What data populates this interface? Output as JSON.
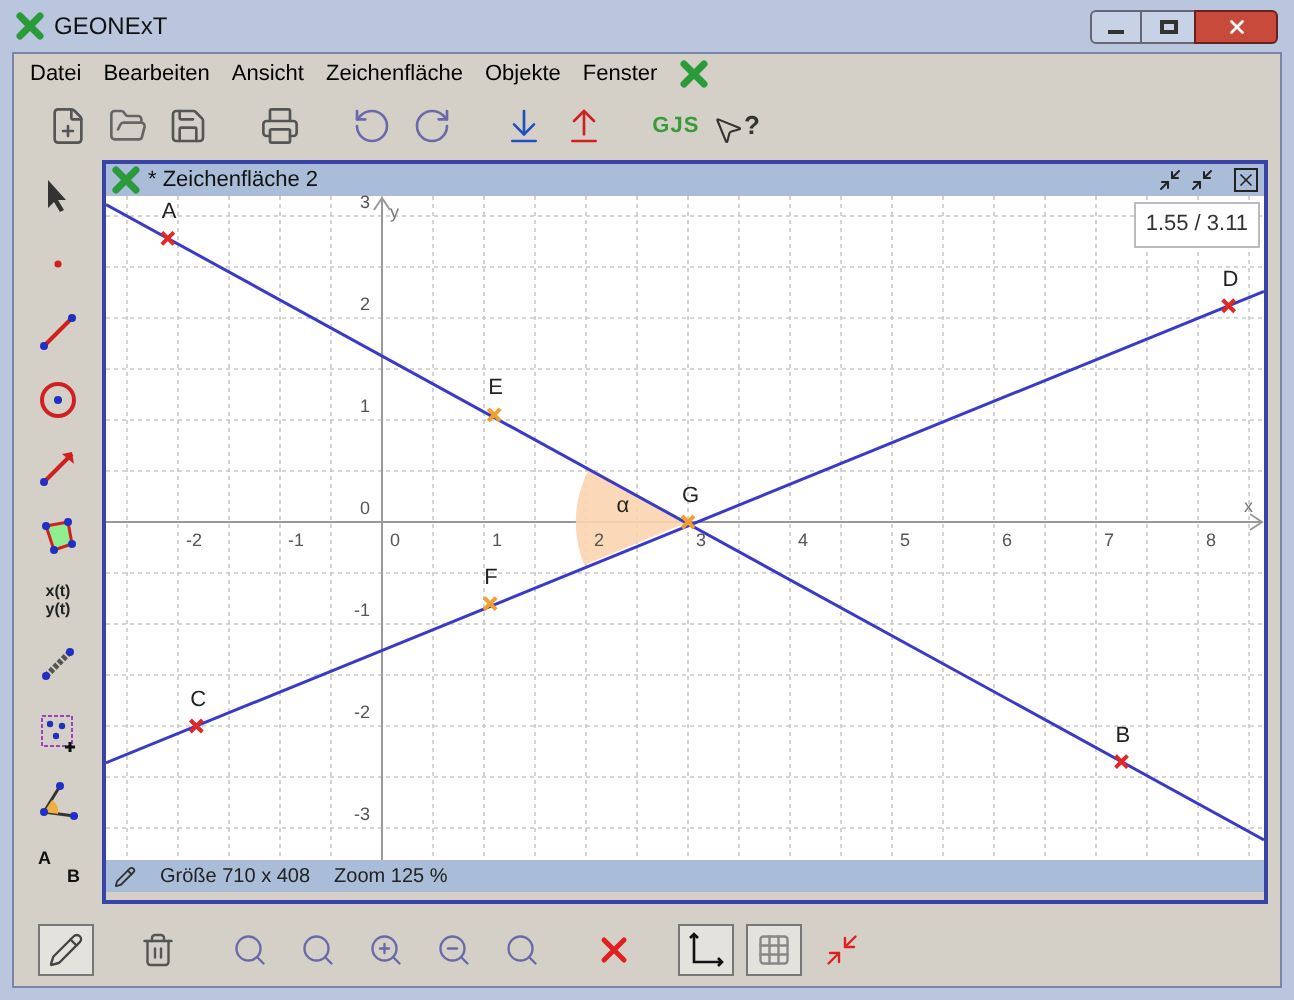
{
  "window": {
    "title": "GEONExT"
  },
  "menu": [
    "Datei",
    "Bearbeiten",
    "Ansicht",
    "Zeichenfläche",
    "Objekte",
    "Fenster"
  ],
  "toolbar": [
    {
      "kind": "new"
    },
    {
      "kind": "open"
    },
    {
      "kind": "save"
    },
    {
      "kind": "print"
    },
    {
      "kind": "undo"
    },
    {
      "kind": "redo"
    },
    {
      "kind": "import"
    },
    {
      "kind": "export"
    },
    {
      "kind": "text",
      "text": "GJS"
    },
    {
      "kind": "help",
      "text": "?"
    }
  ],
  "tools": [
    {
      "kind": "pointer",
      "selected": false
    },
    {
      "kind": "point",
      "selected": false
    },
    {
      "kind": "segment",
      "selected": false
    },
    {
      "kind": "circle",
      "selected": false
    },
    {
      "kind": "arrow",
      "selected": false
    },
    {
      "kind": "polygon",
      "selected": false
    },
    {
      "kind": "curve",
      "texts": [
        "x(t)",
        "y(t)"
      ],
      "selected": false
    },
    {
      "kind": "measure",
      "selected": false
    },
    {
      "kind": "group",
      "selected": false
    },
    {
      "kind": "angle",
      "selected": false
    },
    {
      "kind": "label",
      "texts": [
        "A",
        "B"
      ],
      "selected": false
    }
  ],
  "board": {
    "title": "* Zeichenfläche 2",
    "coordinates": "1.55 / 3.11",
    "x_axis": {
      "label": "x",
      "ticks": [
        "-2",
        "-1",
        "0",
        "1",
        "2",
        "3",
        "4",
        "5",
        "6",
        "7",
        "8"
      ]
    },
    "y_axis": {
      "label": "y",
      "ticks": [
        "3",
        "2",
        "1",
        "0",
        "-1",
        "-2",
        "-3"
      ]
    },
    "points": [
      {
        "label": "A",
        "kind": "free"
      },
      {
        "label": "B",
        "kind": "free"
      },
      {
        "label": "C",
        "kind": "free"
      },
      {
        "label": "D",
        "kind": "free"
      },
      {
        "label": "E",
        "kind": "constructed"
      },
      {
        "label": "F",
        "kind": "constructed"
      },
      {
        "label": "G",
        "kind": "constructed"
      }
    ],
    "angle": {
      "label": "α"
    },
    "status": [
      "Größe 710 x 408",
      "Zoom 125 %"
    ]
  },
  "bottom_toolbar": [
    {
      "kind": "edit",
      "selected": true
    },
    {
      "kind": "trash",
      "selected": false
    },
    {
      "kind": "zoom-fit",
      "selected": false
    },
    {
      "kind": "zoom-box",
      "selected": false
    },
    {
      "kind": "zoom-in",
      "selected": false
    },
    {
      "kind": "zoom-out",
      "selected": false
    },
    {
      "kind": "zoom-reset",
      "selected": false
    },
    {
      "kind": "delete",
      "selected": false
    },
    {
      "kind": "axes",
      "selected": true
    },
    {
      "kind": "grid",
      "selected": true
    },
    {
      "kind": "center",
      "selected": false
    }
  ]
}
